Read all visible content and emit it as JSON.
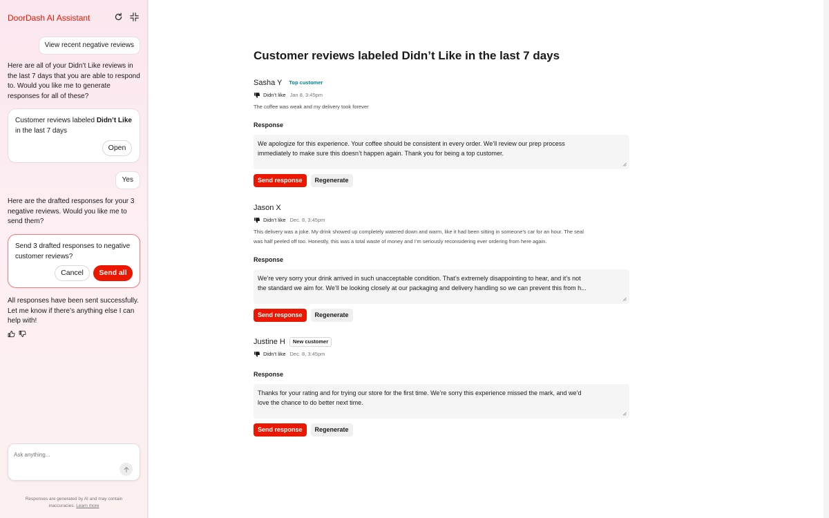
{
  "sidebar": {
    "title": "DoorDash AI Assistant",
    "header_icons": [
      "refresh-icon",
      "collapse-icon"
    ],
    "messages": {
      "user1": "View recent negative reviews",
      "ai1": "Here are all of your Didn’t Like reviews in the last 7 days that you are able to respond to. Would you like me to generate responses for all of these?",
      "card1": {
        "text_before": "Customer reviews labeled ",
        "text_bold": "Didn’t Like",
        "text_after": " in the last 7 days",
        "open_label": "Open"
      },
      "user2": "Yes",
      "ai2": "Here are the drafted responses for your 3 negative reviews. Would you like me to send them?",
      "card2": {
        "text": "Send 3 drafted responses to negative customer reviews?",
        "cancel_label": "Cancel",
        "send_all_label": "Send all"
      },
      "ai3": "All responses have been sent successfully. Let me know if there’s anything else I can help with!"
    },
    "ask_placeholder": "Ask anything...",
    "disclaimer": "Responses are generated by AI and may contain inaccuracies.",
    "learn_more": "Learn more"
  },
  "main": {
    "title": "Customer reviews labeled Didn’t Like in the last 7 days",
    "response_label": "Response",
    "send_label": "Send response",
    "regenerate_label": "Regenerate",
    "reviews": [
      {
        "name": "Sasha Y",
        "badge": "Top customer",
        "rating": "Didn’t like",
        "date": "Jan 8, 3:45pm",
        "text": "The coffee was weak and my delivery took forever",
        "response_lines": [
          "We apologize for this experience. Your coffee should be consistent in every order. We’ll review our prep process",
          "immediately to make sure this doesn’t happen again. Thank you for being a top customer."
        ]
      },
      {
        "name": "Jason X",
        "badge": "",
        "rating": "Didn’t like",
        "date": "Dec. 8, 3:45pm",
        "text_lines": [
          "This delivery was a joke. My drink showed up completely watered down and warm, like it had been sitting in someone’s car for an hour. The seal",
          "was half peeled off too. Honestly, this was a total waste of money and I’m seriously reconsidering ever ordering from here again."
        ],
        "response_lines": [
          "We’re very sorry your drink arrived in such unacceptable condition. That’s extremely disappointing to hear, and it’s not",
          "the standard we aim for. We’ll be looking closely at our packaging and delivery handling so we can prevent this from h..."
        ]
      },
      {
        "name": "Justine H",
        "badge": "New customer",
        "rating": "Didn’t like",
        "date": "Dec. 8, 3:45pm",
        "text": "",
        "response_lines": [
          "Thanks for your rating and for trying our store for the first time. We’re sorry this experience missed the mark, and we’d",
          "love the chance to do better next time."
        ]
      }
    ]
  },
  "colors": {
    "brand_red": "#eb1700",
    "badge_teal": "#00838f"
  }
}
